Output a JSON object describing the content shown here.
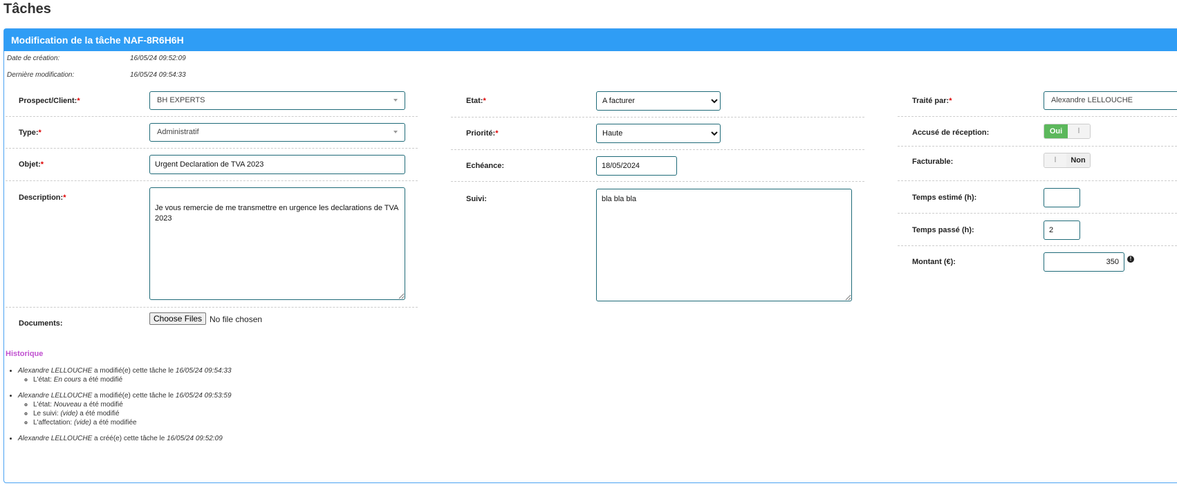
{
  "page": {
    "title": "Tâches"
  },
  "panel": {
    "header": "Modification de la tâche NAF-8R6H6H"
  },
  "meta": {
    "created_label": "Date de création:",
    "created_value": "16/05/24 09:52:09",
    "modified_label": "Dernière modification:",
    "modified_value": "16/05/24 09:54:33"
  },
  "form": {
    "client": {
      "label": "Prospect/Client:",
      "value": "BH EXPERTS"
    },
    "type": {
      "label": "Type:",
      "value": "Administratif"
    },
    "objet": {
      "label": "Objet:",
      "value": "Urgent Declaration de TVA 2023"
    },
    "description": {
      "label": "Description:",
      "value": "\nJe vous remercie de me transmettre en urgence les declarations de TVA 2023"
    },
    "documents": {
      "label": "Documents:",
      "button": "Choose Files",
      "status": "No file chosen"
    },
    "etat": {
      "label": "Etat:",
      "value": "A facturer"
    },
    "priorite": {
      "label": "Priorité:",
      "value": "Haute"
    },
    "echeance": {
      "label": "Echéance:",
      "value": "18/05/2024"
    },
    "suivi": {
      "label": "Suivi:",
      "value": "bla bla bla"
    },
    "traite_par": {
      "label": "Traité par:",
      "value": "Alexandre LELLOUCHE"
    },
    "accuse": {
      "label": "Accusé de réception:",
      "on": "Oui",
      "handle": "⦙",
      "state": "on"
    },
    "facturable": {
      "label": "Facturable:",
      "off": "Non",
      "handle": "⦙",
      "state": "off"
    },
    "temps_estime": {
      "label": "Temps estimé (h):",
      "value": ""
    },
    "temps_passe": {
      "label": "Temps passé (h):",
      "value": "2"
    },
    "montant": {
      "label": "Montant (€):",
      "value": "350",
      "icon": "exclamation-circle-icon"
    }
  },
  "historique": {
    "title": "Historique",
    "entries": [
      {
        "user": "Alexandre LELLOUCHE",
        "action": " a modifié(e) cette tâche le ",
        "date": "16/05/24 09:54:33",
        "changes": [
          {
            "pre": "L'état: ",
            "val": "En cours",
            "post": " a été modifié"
          }
        ]
      },
      {
        "user": "Alexandre LELLOUCHE",
        "action": " a modifié(e) cette tâche le ",
        "date": "16/05/24 09:53:59",
        "changes": [
          {
            "pre": "L'état: ",
            "val": "Nouveau",
            "post": " a été modifié"
          },
          {
            "pre": "Le suivi: ",
            "val": "(vide)",
            "post": " a été modifié"
          },
          {
            "pre": "L'affectation: ",
            "val": "(vide)",
            "post": " a été modifiée"
          }
        ]
      },
      {
        "user": "Alexandre LELLOUCHE",
        "action": " a créé(e) cette tâche le ",
        "date": "16/05/24 09:52:09"
      }
    ]
  },
  "required_mark": "*"
}
